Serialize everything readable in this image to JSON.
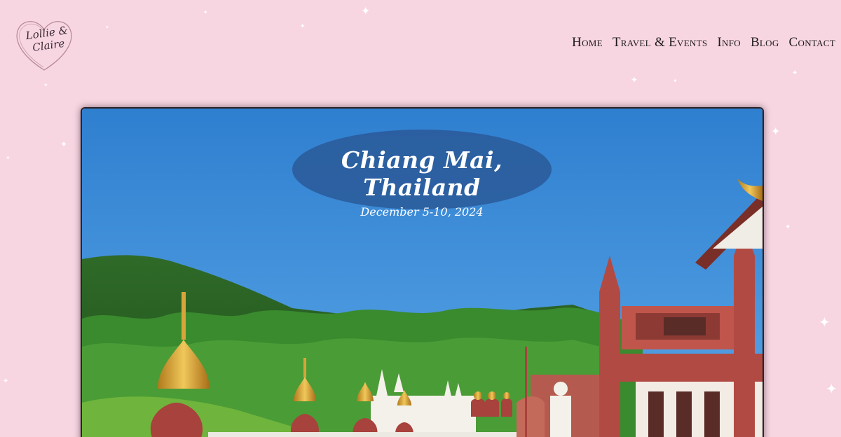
{
  "logo": {
    "line1": "Lollie &",
    "line2": "Claire"
  },
  "nav": {
    "items": [
      "Home",
      "Travel & Events",
      "Info",
      "Blog",
      "Contact"
    ]
  },
  "hero": {
    "title": "Chiang Mai, Thailand",
    "dates": "December 5-10, 2024"
  },
  "colors": {
    "background": "#f7d6e2",
    "sky": "#3d8fd6",
    "oval": "#2a5896",
    "temple_red": "#b24a44",
    "gold": "#d9a53a"
  }
}
